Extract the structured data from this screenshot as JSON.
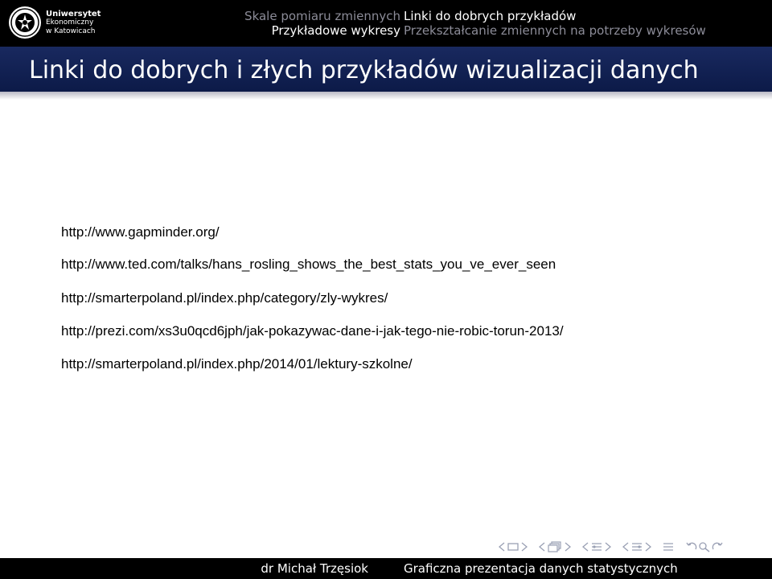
{
  "header": {
    "logo_lines": [
      "Uniwersytet",
      "Ekonomiczny",
      "w Katowicach"
    ],
    "sections": [
      "Skale pomiaru zmiennych",
      "Przykładowe wykresy"
    ],
    "subsections": [
      "Linki do dobrych przykładów",
      "Przekształcanie zmiennych na potrzeby wykresów"
    ]
  },
  "frame": {
    "title": "Linki do dobrych i złych przykładów wizualizacji danych"
  },
  "links": [
    "http://www.gapminder.org/",
    "http://www.ted.com/talks/hans_rosling_shows_the_best_stats_you_ve_ever_seen",
    "http://smarterpoland.pl/index.php/category/zly-wykres/",
    "http://prezi.com/xs3u0qcd6jph/jak-pokazywac-dane-i-jak-tego-nie-robic-torun-2013/",
    "http://smarterpoland.pl/index.php/2014/01/lektury-szkolne/"
  ],
  "footer": {
    "author": "dr Michał Trzęsiok",
    "title": "Graficzna prezentacja danych statystycznych"
  },
  "icons": {
    "logo": "university-seal-icon",
    "nav": [
      "prev-arrow-icon",
      "frame-icon",
      "next-arrow-icon",
      "subsection-icon",
      "section-icon",
      "align-icon",
      "search-icon"
    ]
  },
  "colors": {
    "topbar": "#000000",
    "titlebar": "#19295f",
    "nav_inactive": "#8c8c98",
    "nav_symbols": "#9aa0b4"
  }
}
